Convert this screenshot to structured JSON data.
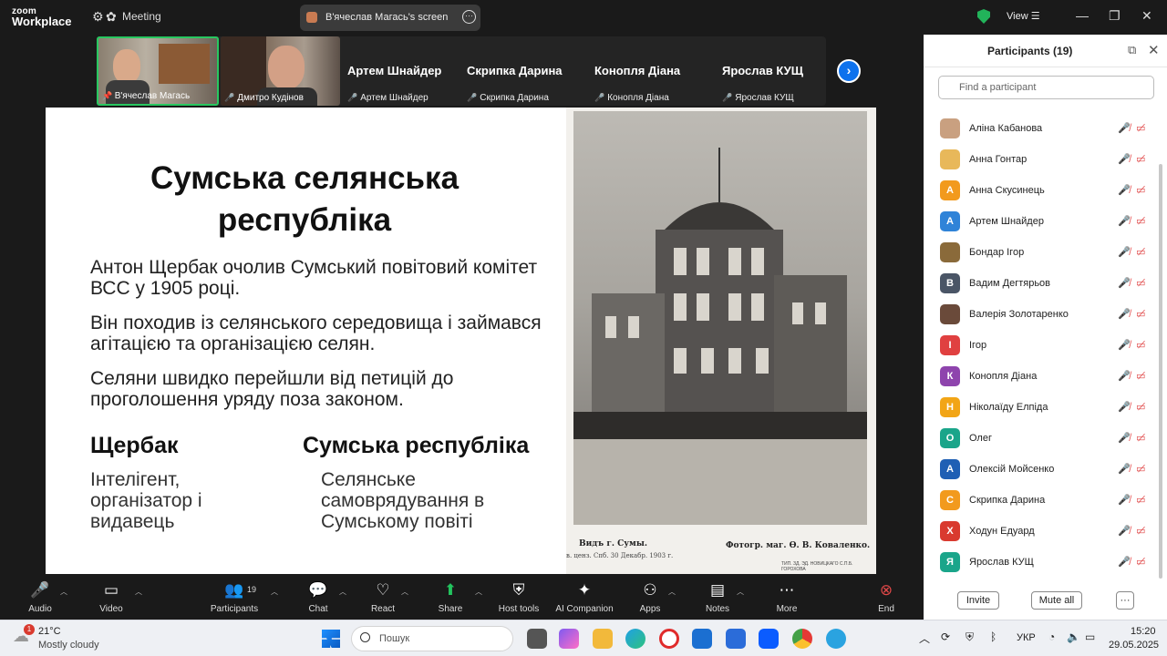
{
  "app": {
    "brand_top": "zoom",
    "brand_bottom": "Workplace",
    "meeting_label": "Meeting",
    "screen_label": "В'ячеслав Магась's screen",
    "view_label": "View",
    "accent": "#0e72ed"
  },
  "video_strip": {
    "tiles": [
      {
        "name": "В'ячеслав Магась"
      },
      {
        "name": "Дмитро Кудінов"
      }
    ],
    "name_tiles": [
      {
        "name": "Артем Шнайдер",
        "sub": "Артем Шнайдер"
      },
      {
        "name": "Скрипка Дарина",
        "sub": "Скрипка Дарина"
      },
      {
        "name": "Конопля Діана",
        "sub": "Конопля Діана"
      },
      {
        "name": "Ярослав КУЩ",
        "sub": "Ярослав КУЩ"
      }
    ]
  },
  "slide": {
    "title_l1": "Сумська селянська",
    "title_l2": "республіка",
    "p1": "Антон Щербак очолив Сумський повітовий комітет ВСС у 1905 році.",
    "p2": "Він походив із селянського середовища і займався агітацією та організацією селян.",
    "p3": "Селяни швидко перейшли від петицій до проголошення уряду поза законом.",
    "h1": "Щербак",
    "s1_l1": "Інтелігент,",
    "s1_l2": "організатор і",
    "s1_l3": "видавець",
    "h2": "Сумська республіка",
    "s2_l1": "Селянське",
    "s2_l2": "самоврядування в",
    "s2_l3": "Сумському повіті",
    "cap1": "Видъ г. Сумы.",
    "cap2": "Фотогр. маг. Ѳ. В. Коваленко.",
    "cap3": "в. ценз. Спб. 30 Декабр. 1903 г.",
    "cap4": "ТИП. ЗД. ЭД. НОВИЦКАГО С.П.Б. ГОРОХОВА"
  },
  "participants": {
    "title": "Participants (19)",
    "search_placeholder": "Find a participant",
    "list": [
      {
        "name": "Аліна Кабанова",
        "initial": "",
        "color": "#c9a080"
      },
      {
        "name": "Анна Гонтар",
        "initial": "",
        "color": "#e8b85a"
      },
      {
        "name": "Анна Скусинець",
        "initial": "А",
        "color": "#f29a1d"
      },
      {
        "name": "Артем Шнайдер",
        "initial": "А",
        "color": "#2f83d8"
      },
      {
        "name": "Бондар Ігор",
        "initial": "",
        "color": "#8a6a3a"
      },
      {
        "name": "Вадим Дегтярьов",
        "initial": "В",
        "color": "#4a5566"
      },
      {
        "name": "Валерія Золотаренко",
        "initial": "",
        "color": "#6a4a3a"
      },
      {
        "name": "Ігор",
        "initial": "І",
        "color": "#e04040"
      },
      {
        "name": "Конопля Діана",
        "initial": "К",
        "color": "#8e44ad"
      },
      {
        "name": "Ніколаїду Елпіда",
        "initial": "Н",
        "color": "#f2a516"
      },
      {
        "name": "Олег",
        "initial": "О",
        "color": "#1aa58a"
      },
      {
        "name": "Олексій Мойсенко",
        "initial": "А",
        "color": "#1f5fb4"
      },
      {
        "name": "Скрипка Дарина",
        "initial": "С",
        "color": "#f29a1d"
      },
      {
        "name": "Ходун Едуард",
        "initial": "Х",
        "color": "#d93a2f"
      },
      {
        "name": "Ярослав КУЩ",
        "initial": "Я",
        "color": "#1aa58a"
      }
    ],
    "invite": "Invite",
    "mute_all": "Mute all",
    "more": "···"
  },
  "toolbar": {
    "audio": "Audio",
    "video": "Video",
    "participants": "Participants",
    "participants_count": "19",
    "chat": "Chat",
    "react": "React",
    "share": "Share",
    "host_tools": "Host tools",
    "ai": "AI Companion",
    "apps": "Apps",
    "notes": "Notes",
    "more": "More",
    "end": "End"
  },
  "taskbar": {
    "weather_temp": "21°C",
    "weather_desc": "Mostly cloudy",
    "weather_badge": "1",
    "search_placeholder": "Пошук",
    "lang": "УКР",
    "time": "15:20",
    "date": "29.05.2025"
  }
}
